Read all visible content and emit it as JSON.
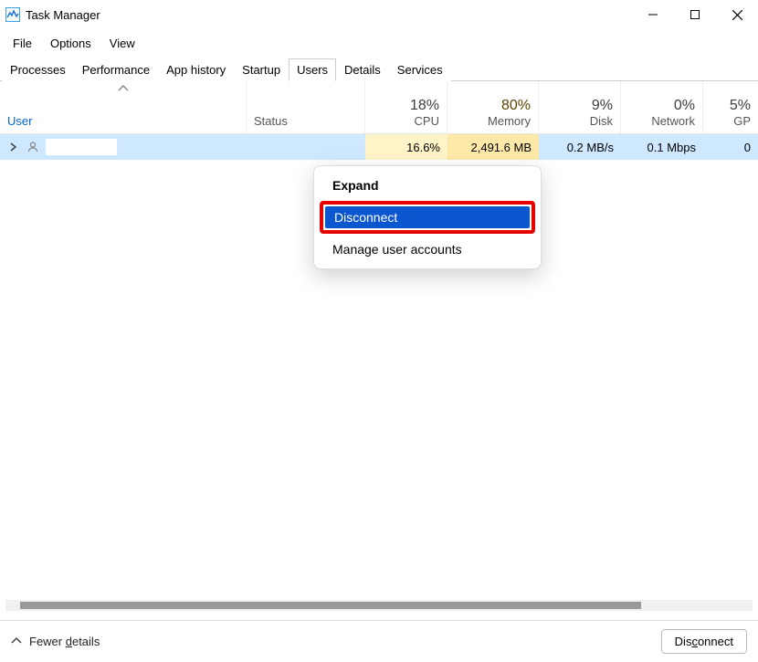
{
  "window": {
    "title": "Task Manager"
  },
  "menu": {
    "file": "File",
    "options": "Options",
    "view": "View"
  },
  "tabs": {
    "processes": "Processes",
    "performance": "Performance",
    "app_history": "App history",
    "startup": "Startup",
    "users": "Users",
    "details": "Details",
    "services": "Services"
  },
  "columns": {
    "user": "User",
    "status": "Status",
    "cpu_pct": "18%",
    "cpu_lbl": "CPU",
    "mem_pct": "80%",
    "mem_lbl": "Memory",
    "disk_pct": "9%",
    "disk_lbl": "Disk",
    "net_pct": "0%",
    "net_lbl": "Network",
    "gpu_pct": "5%",
    "gpu_lbl": "GP"
  },
  "row": {
    "cpu": "16.6%",
    "mem": "2,491.6 MB",
    "disk": "0.2 MB/s",
    "net": "0.1 Mbps",
    "gpu": "0"
  },
  "context": {
    "expand": "Expand",
    "disconnect": "Disconnect",
    "manage": "Manage user accounts"
  },
  "footer": {
    "fewer_prefix": "Fewer ",
    "fewer_u": "d",
    "fewer_suffix": "etails",
    "disconnect_prefix": "Dis",
    "disconnect_u": "c",
    "disconnect_suffix": "onnect"
  }
}
